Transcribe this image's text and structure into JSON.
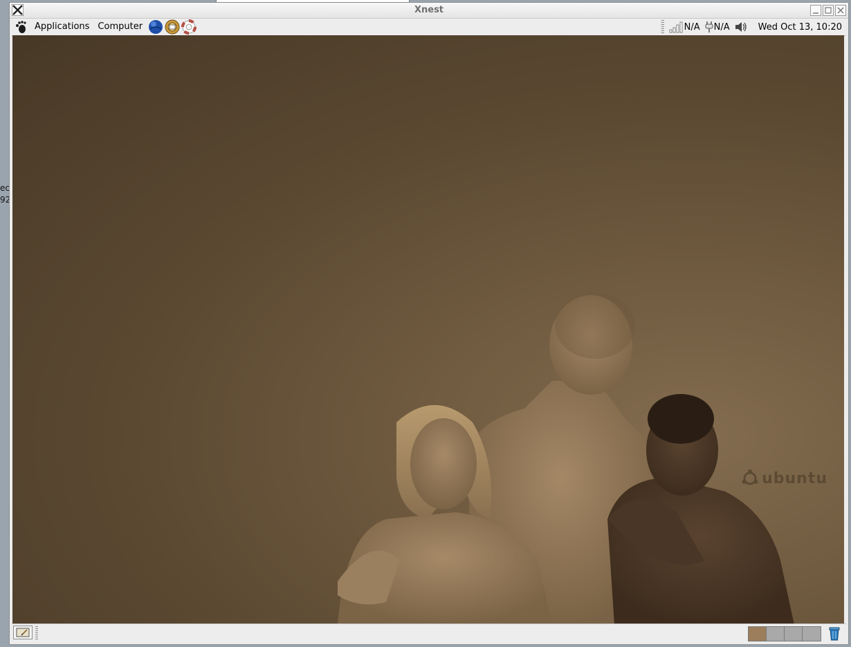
{
  "host": {
    "left_edge_text": [
      "ec",
      "92"
    ]
  },
  "window": {
    "title": "Xnest"
  },
  "top_panel": {
    "menus": [
      "Applications",
      "Computer"
    ],
    "launchers": [
      "web-browser-icon",
      "mail-client-icon",
      "help-lifebuoy-icon"
    ],
    "network_status": "N/A",
    "power_status": "N/A",
    "clock": "Wed Oct 13, 10:20"
  },
  "desktop": {
    "brand_text": "ubuntu"
  },
  "bottom_panel": {
    "workspaces": {
      "count": 4,
      "active_index": 0
    }
  },
  "colors": {
    "desktop_bg": "#5a4831",
    "workspace_active": "#9c7e5c",
    "workspace_inactive": "#a9a9a9",
    "panel_bg": "#ededed"
  }
}
